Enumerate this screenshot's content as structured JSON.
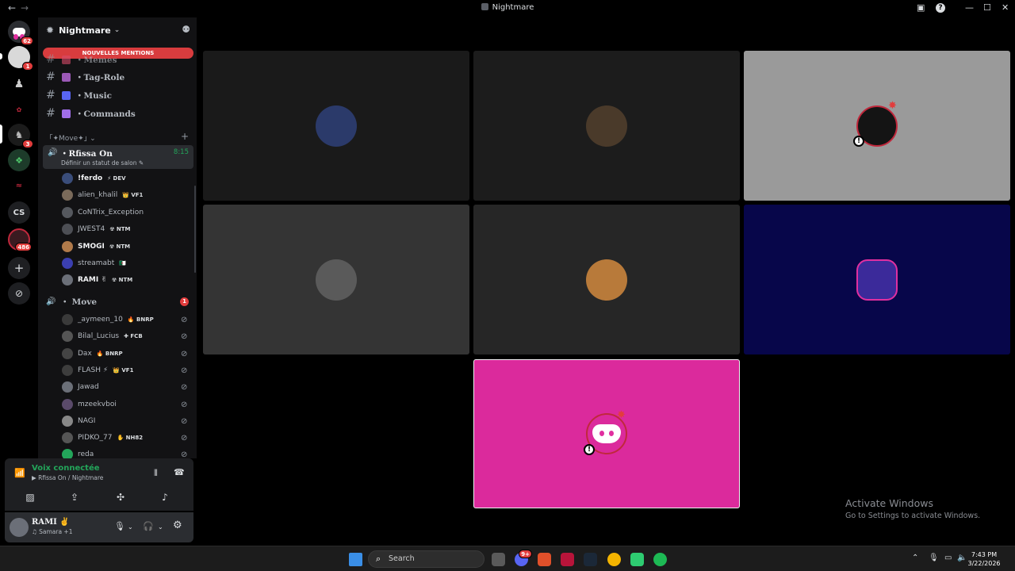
{
  "window": {
    "title": "Nightmare",
    "back_glyph": "←",
    "forward_glyph": "→",
    "inbox_glyph": "▣",
    "help_glyph": "?",
    "min_glyph": "—",
    "max_glyph": "☐",
    "close_glyph": "✕"
  },
  "rail": {
    "home_badge": "62",
    "server_badges": [
      "1",
      "3",
      "486"
    ],
    "cs_label": "CS",
    "add_glyph": "+",
    "explore_glyph": "⊘"
  },
  "server": {
    "name": "Nightmare",
    "chevron": "⌄",
    "mentions_banner": "NOUVELLES MENTIONS",
    "channels": [
      {
        "label": "・Memes",
        "emoji_color": "#d84b6a"
      },
      {
        "label": "・Tag-Role",
        "emoji_color": "#9b59b6"
      },
      {
        "label": "・Music",
        "emoji_color": "#5865f2"
      },
      {
        "label": "・Commands",
        "emoji_color": "#a06ee8"
      }
    ],
    "category": "｢✦Move✦｣ ⌄",
    "active_voice": {
      "name": "・Rfissa On",
      "time": "8:15",
      "status": "Définir un statut de salon ✎"
    },
    "active_members": [
      {
        "name": "!ferdo",
        "tag": "⚡ DEV",
        "color": "#3a4d7a"
      },
      {
        "name": "alien_khalil",
        "tag": "👑 VF1",
        "color": "#7a6a5a"
      },
      {
        "name": "CoNTrix_Exception",
        "tag": "",
        "color": "#55585e"
      },
      {
        "name": "JWEST4",
        "tag": "☢ NTM",
        "color": "#4d4f55"
      },
      {
        "name": "SMOGI",
        "tag": "☢ NTM",
        "color": "#b07a4a"
      },
      {
        "name": "streamabt",
        "tag": "🇩🇿",
        "color": "#3b3fb0"
      },
      {
        "name": "RAMI ✌",
        "tag": "☢ NTM",
        "color": "#6b6f78"
      }
    ],
    "voice2": {
      "name": "・ Move",
      "count": "1"
    },
    "move_members": [
      {
        "name": "_aymeen_10",
        "tag": "🔥 BNRP",
        "color": "#3a3a3a"
      },
      {
        "name": "Bilal_Lucius",
        "tag": "✚ FCB",
        "color": "#555"
      },
      {
        "name": "Dax",
        "tag": "🔥 BNRP",
        "color": "#444"
      },
      {
        "name": "FLASH ⚡",
        "tag": "👑 VF1",
        "color": "#3d3d3d"
      },
      {
        "name": "Jawad",
        "tag": "",
        "color": "#6b6f78"
      },
      {
        "name": "mzeekvboi",
        "tag": "",
        "color": "#5a4a6a"
      },
      {
        "name": "NAGI",
        "tag": "",
        "color": "#888"
      },
      {
        "name": "PIDKO_77",
        "tag": "✋ NH82",
        "color": "#555"
      },
      {
        "name": "reda",
        "tag": "",
        "color": "#23a55a"
      }
    ]
  },
  "voice_panel": {
    "title": "Voix connectée",
    "channel": "▶ Rfissa On / Nightmare"
  },
  "user": {
    "name": "RAMI ✌",
    "activity": "♫ Samara +1",
    "mic_glyph": "🎙",
    "headset_glyph": "🎧",
    "settings_glyph": "⚙"
  },
  "video_tiles": [
    {
      "bg": "#1a1a1a",
      "avatar": "#2b3a6a"
    },
    {
      "bg": "#1c1c1c",
      "avatar": "#4a3a2a"
    },
    {
      "bg": "#9a9a9a",
      "avatar": "#141414"
    },
    {
      "bg": "#343434",
      "avatar": "#5a5a5a"
    },
    {
      "bg": "#262626",
      "avatar": "#b87a3a"
    },
    {
      "bg": "#07064a",
      "avatar": "#3b2a9a"
    },
    {
      "bg": "#db2a9c",
      "avatar": "#db2a9c"
    }
  ],
  "activate_windows": {
    "line1": "Activate Windows",
    "line2": "Go to Settings to activate Windows."
  },
  "taskbar": {
    "search_placeholder": "Search",
    "search_glyph": "⌕",
    "discord_badge": "9+",
    "time": "7:43 PM",
    "date": "3/22/2026"
  }
}
